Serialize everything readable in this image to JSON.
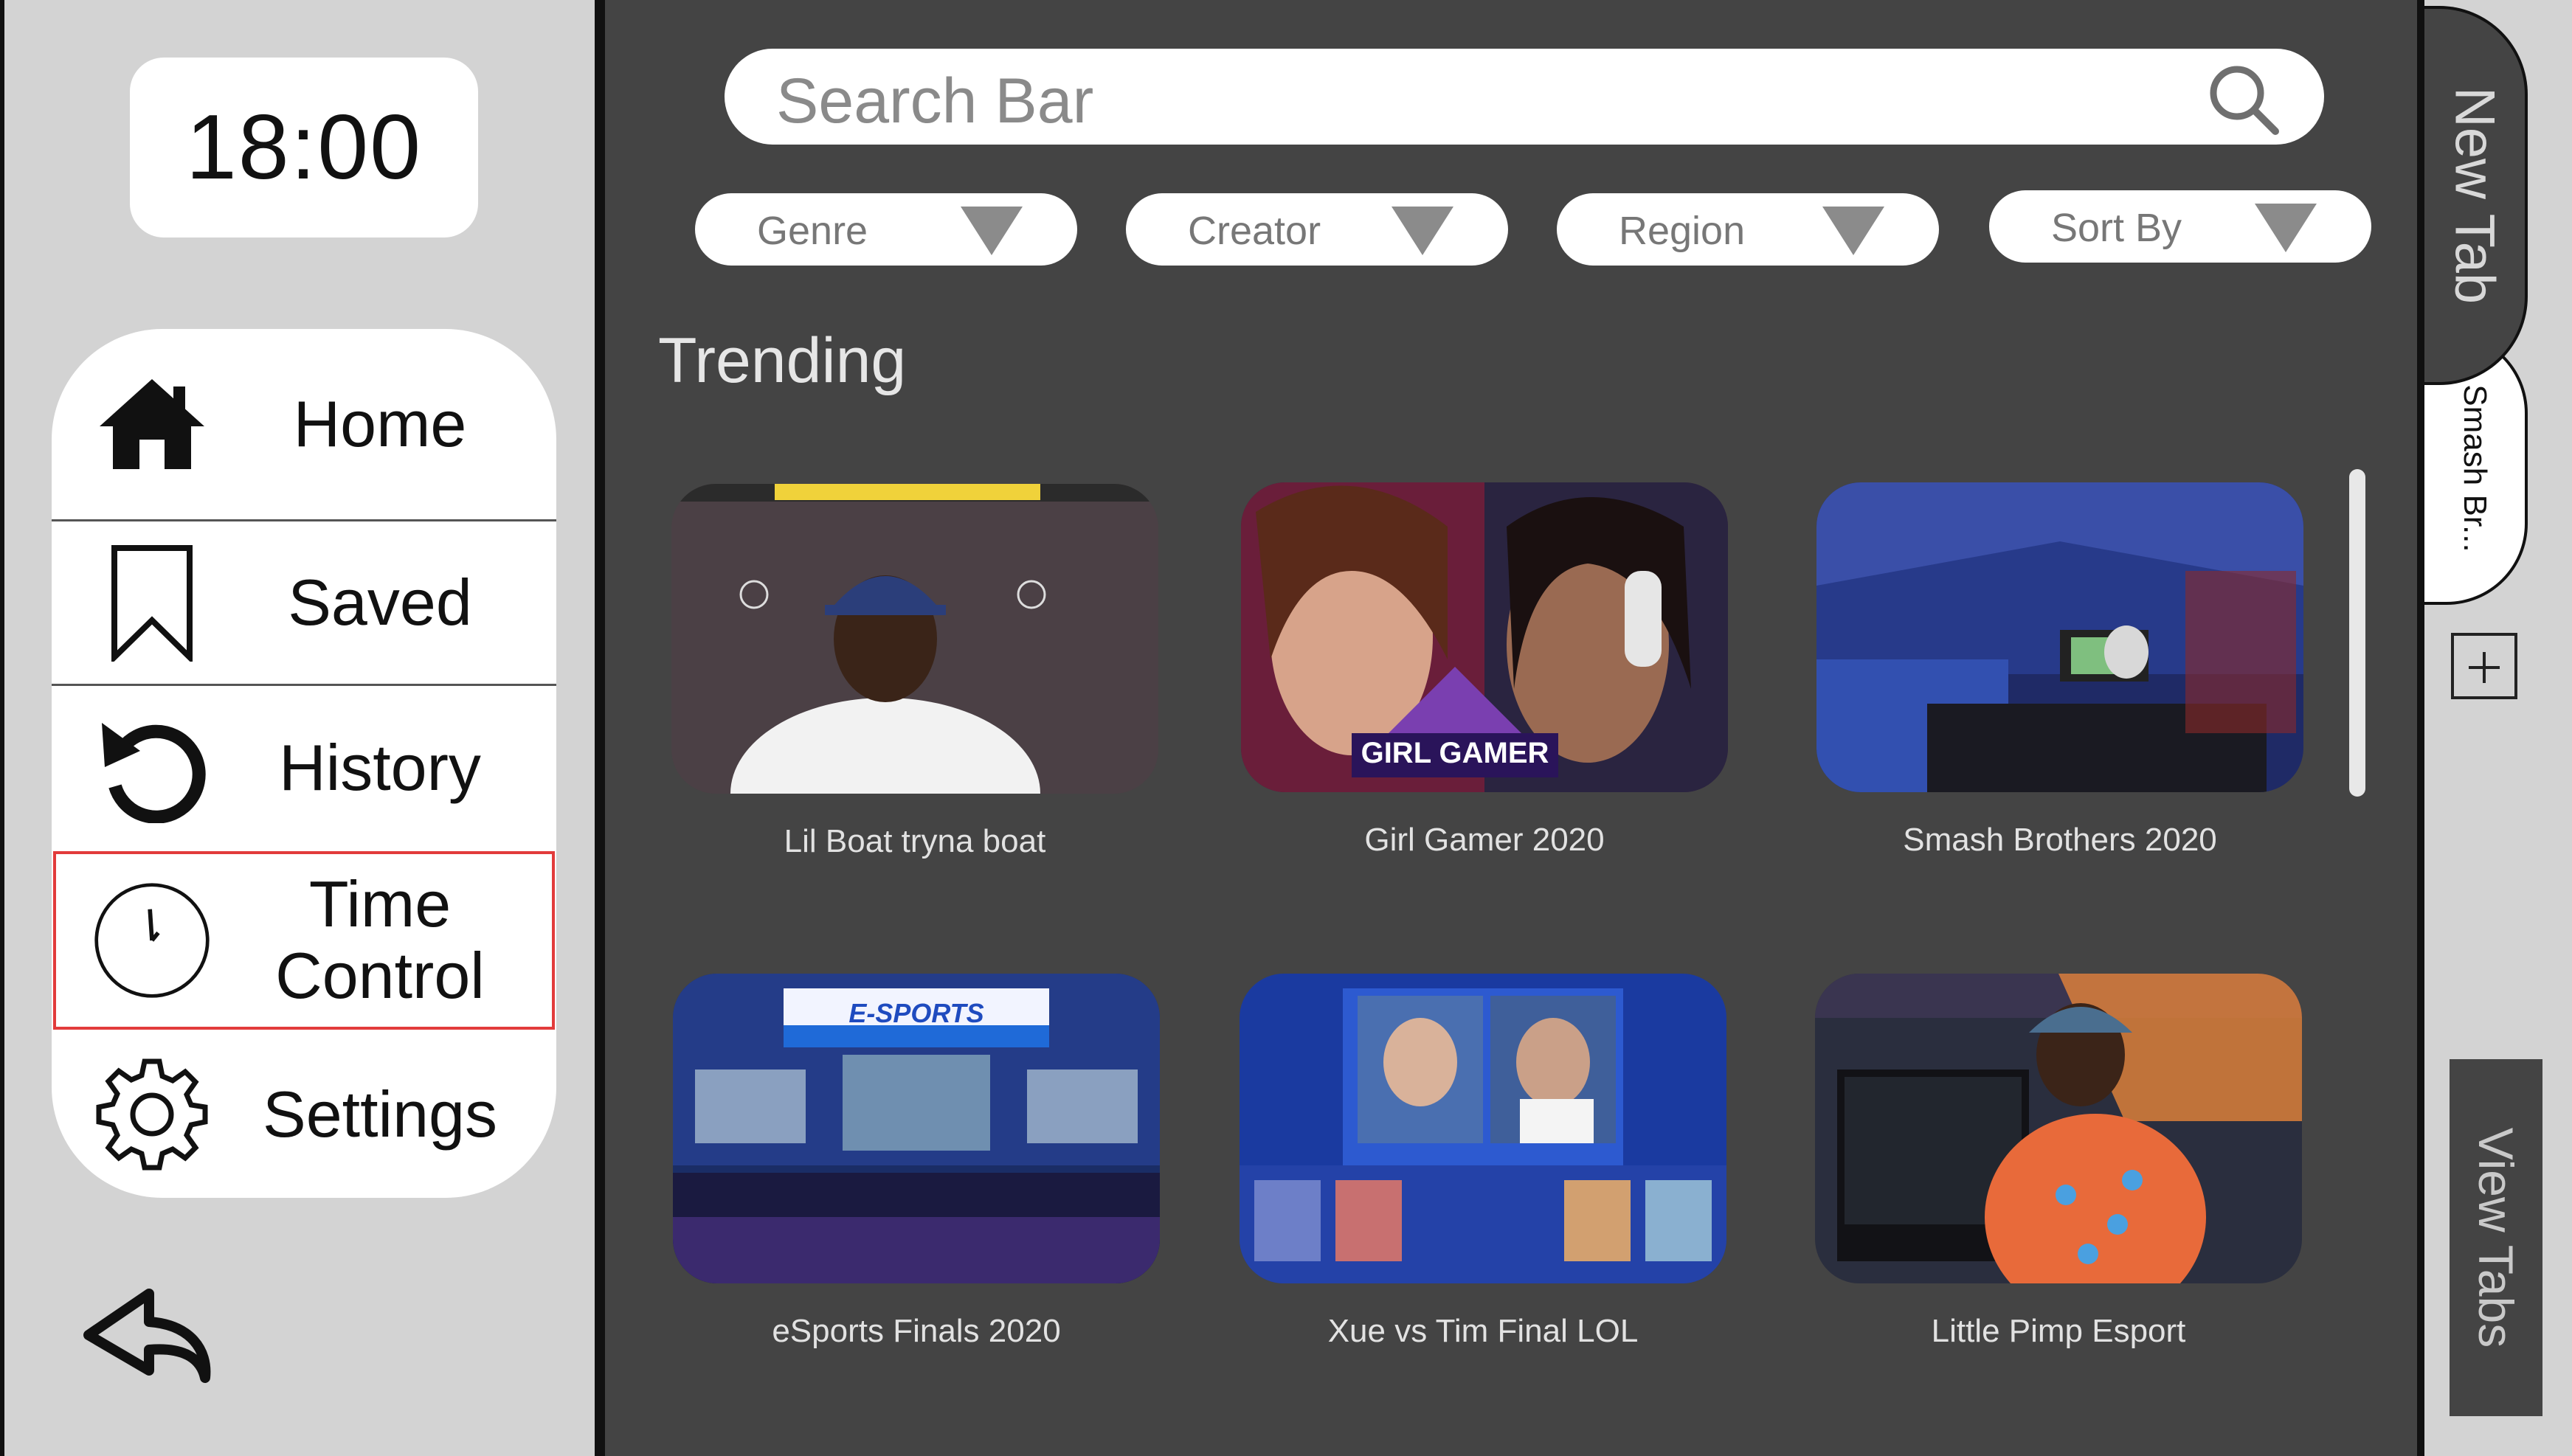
{
  "clock": {
    "time": "18:00"
  },
  "menu": {
    "items": [
      {
        "label": "Home",
        "icon": "home-icon"
      },
      {
        "label": "Saved",
        "icon": "bookmark-icon"
      },
      {
        "label": "History",
        "icon": "history-icon"
      },
      {
        "label": "Time Control",
        "line1": "Time",
        "line2": "Control",
        "icon": "clock-icon",
        "selected": true
      },
      {
        "label": "Settings",
        "icon": "gear-icon"
      }
    ]
  },
  "search": {
    "placeholder": "Search Bar"
  },
  "filters": [
    {
      "label": "Genre"
    },
    {
      "label": "Creator"
    },
    {
      "label": "Region"
    },
    {
      "label": "Sort By"
    }
  ],
  "section": {
    "title": "Trending"
  },
  "videos": [
    {
      "title": "Lil Boat tryna boat"
    },
    {
      "title": "Girl Gamer 2020",
      "overlay_text": "GIRL GAMER"
    },
    {
      "title": "Smash Brothers 2020"
    },
    {
      "title": "eSports Finals 2020",
      "overlay_text": "E-SPORTS"
    },
    {
      "title": "Xue vs Tim Final LOL"
    },
    {
      "title": "Little Pimp Esport"
    }
  ],
  "tabs": {
    "new_tab": "New Tab",
    "open_tab": "Smash Br...",
    "view_tabs": "View Tabs"
  },
  "colors": {
    "main_bg": "#444444",
    "sidebar_bg": "#d3d3d3",
    "selection_outline": "#e23b3b"
  }
}
